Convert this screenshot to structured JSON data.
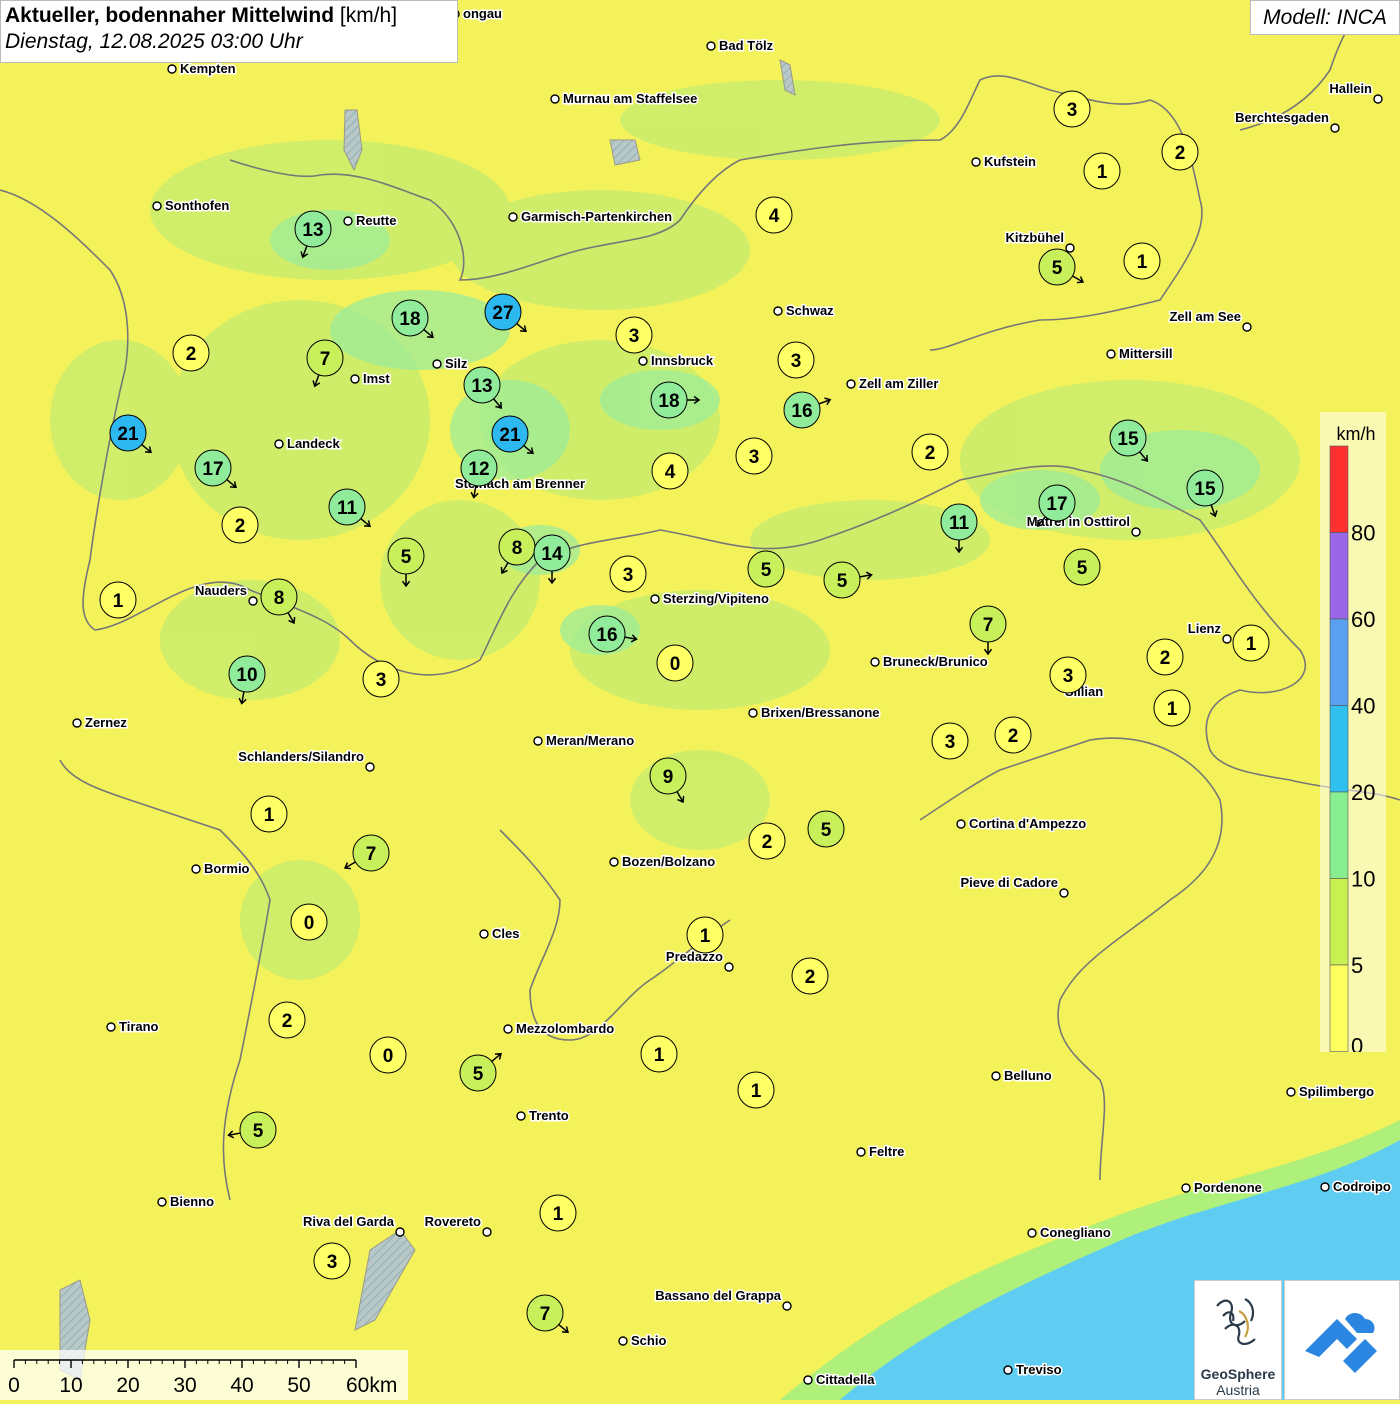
{
  "title": "Aktueller, bodennaher Mittelwind",
  "unit": "[km/h]",
  "subtitle": "Dienstag, 12.08.2025 03:00 Uhr",
  "model": "Modell: INCA",
  "legend": {
    "unit": "km/h",
    "labels": [
      "80",
      "60",
      "40",
      "20",
      "10",
      "5",
      "0"
    ],
    "colors": [
      "#ff3030",
      "#9a66e8",
      "#5aa0f0",
      "#30c0f0",
      "#88ee90",
      "#c8f050",
      "#ffff60"
    ]
  },
  "scalebar": {
    "labels": [
      "0",
      "10",
      "20",
      "30",
      "40",
      "50",
      "60km"
    ]
  },
  "logos": {
    "geosphere_line1": "GeoSphere",
    "geosphere_line2": "Austria"
  },
  "cities": [
    {
      "name": "Kempten"
    },
    {
      "name": "Bad Tölz"
    },
    {
      "name": "Murnau am Staffelsee"
    },
    {
      "name": "Hallein"
    },
    {
      "name": "Berchtesgaden"
    },
    {
      "name": "Kufstein"
    },
    {
      "name": "Sonthofen"
    },
    {
      "name": "Reutte"
    },
    {
      "name": "Garmisch-Partenkirchen"
    },
    {
      "name": "Kitzbühel"
    },
    {
      "name": "Schwaz"
    },
    {
      "name": "Zell am See"
    },
    {
      "name": "Silz"
    },
    {
      "name": "Innsbruck"
    },
    {
      "name": "Imst"
    },
    {
      "name": "Mittersill"
    },
    {
      "name": "Zell am Ziller"
    },
    {
      "name": "Landeck"
    },
    {
      "name": "Steinach am Brenner"
    },
    {
      "name": "Matrei in Osttirol"
    },
    {
      "name": "Nauders"
    },
    {
      "name": "Sterzing/Vipiteno"
    },
    {
      "name": "Lienz"
    },
    {
      "name": "Bruneck/Brunico"
    },
    {
      "name": "Sillian"
    },
    {
      "name": "Zernez"
    },
    {
      "name": "Brixen/Bressanone"
    },
    {
      "name": "Meran/Merano"
    },
    {
      "name": "Schlanders/Silandro"
    },
    {
      "name": "Cortina d'Ampezzo"
    },
    {
      "name": "Bormio"
    },
    {
      "name": "Bozen/Bolzano"
    },
    {
      "name": "Pieve di Cadore"
    },
    {
      "name": "Cles"
    },
    {
      "name": "Predazzo"
    },
    {
      "name": "Tirano"
    },
    {
      "name": "Mezzolombardo"
    },
    {
      "name": "Belluno"
    },
    {
      "name": "Spilimbergo"
    },
    {
      "name": "Trento"
    },
    {
      "name": "Feltre"
    },
    {
      "name": "Pordenone"
    },
    {
      "name": "Codroipo"
    },
    {
      "name": "Bienno"
    },
    {
      "name": "Riva del Garda"
    },
    {
      "name": "Rovereto"
    },
    {
      "name": "Conegliano"
    },
    {
      "name": "Bassano del Grappa"
    },
    {
      "name": "Schio"
    },
    {
      "name": "Treviso"
    },
    {
      "name": "Cittadella"
    },
    {
      "name": "ongau"
    }
  ],
  "stations": [
    {
      "value": "3",
      "dir": null
    },
    {
      "value": "2",
      "dir": null
    },
    {
      "value": "1",
      "dir": null
    },
    {
      "value": "4",
      "dir": null
    },
    {
      "value": "13",
      "dir": 200
    },
    {
      "value": "1",
      "dir": null
    },
    {
      "value": "5",
      "dir": 120
    },
    {
      "value": "27",
      "dir": 130
    },
    {
      "value": "18",
      "dir": 130
    },
    {
      "value": "3",
      "dir": null
    },
    {
      "value": "2",
      "dir": null
    },
    {
      "value": "7",
      "dir": 200
    },
    {
      "value": "3",
      "dir": null
    },
    {
      "value": "13",
      "dir": 140
    },
    {
      "value": "18",
      "dir": 90
    },
    {
      "value": "16",
      "dir": 70
    },
    {
      "value": "21",
      "dir": 130
    },
    {
      "value": "21",
      "dir": 130
    },
    {
      "value": "15",
      "dir": 140
    },
    {
      "value": "17",
      "dir": 130
    },
    {
      "value": "2",
      "dir": null
    },
    {
      "value": "3",
      "dir": null
    },
    {
      "value": "12",
      "dir": 190
    },
    {
      "value": "4",
      "dir": null
    },
    {
      "value": "15",
      "dir": 160
    },
    {
      "value": "11",
      "dir": 130
    },
    {
      "value": "17",
      "dir": 220
    },
    {
      "value": "2",
      "dir": null
    },
    {
      "value": "11",
      "dir": 180
    },
    {
      "value": "8",
      "dir": 210
    },
    {
      "value": "14",
      "dir": 180
    },
    {
      "value": "5",
      "dir": 180
    },
    {
      "value": "1",
      "dir": null
    },
    {
      "value": "5",
      "dir": null
    },
    {
      "value": "5",
      "dir": null
    },
    {
      "value": "3",
      "dir": null
    },
    {
      "value": "5",
      "dir": 80
    },
    {
      "value": "8",
      "dir": 150
    },
    {
      "value": "16",
      "dir": 100
    },
    {
      "value": "7",
      "dir": 180
    },
    {
      "value": "1",
      "dir": null
    },
    {
      "value": "0",
      "dir": null
    },
    {
      "value": "2",
      "dir": null
    },
    {
      "value": "10",
      "dir": 190
    },
    {
      "value": "3",
      "dir": null
    },
    {
      "value": "3",
      "dir": null
    },
    {
      "value": "1",
      "dir": null
    },
    {
      "value": "2",
      "dir": null
    },
    {
      "value": "3",
      "dir": null
    },
    {
      "value": "9",
      "dir": 150
    },
    {
      "value": "1",
      "dir": null
    },
    {
      "value": "5",
      "dir": null
    },
    {
      "value": "2",
      "dir": null
    },
    {
      "value": "7",
      "dir": 240
    },
    {
      "value": "0",
      "dir": null
    },
    {
      "value": "1",
      "dir": null
    },
    {
      "value": "2",
      "dir": null
    },
    {
      "value": "2",
      "dir": null
    },
    {
      "value": "0",
      "dir": null
    },
    {
      "value": "1",
      "dir": null
    },
    {
      "value": "5",
      "dir": 50
    },
    {
      "value": "1",
      "dir": null
    },
    {
      "value": "5",
      "dir": 260
    },
    {
      "value": "1",
      "dir": null
    },
    {
      "value": "3",
      "dir": null
    },
    {
      "value": "7",
      "dir": 130
    }
  ]
}
